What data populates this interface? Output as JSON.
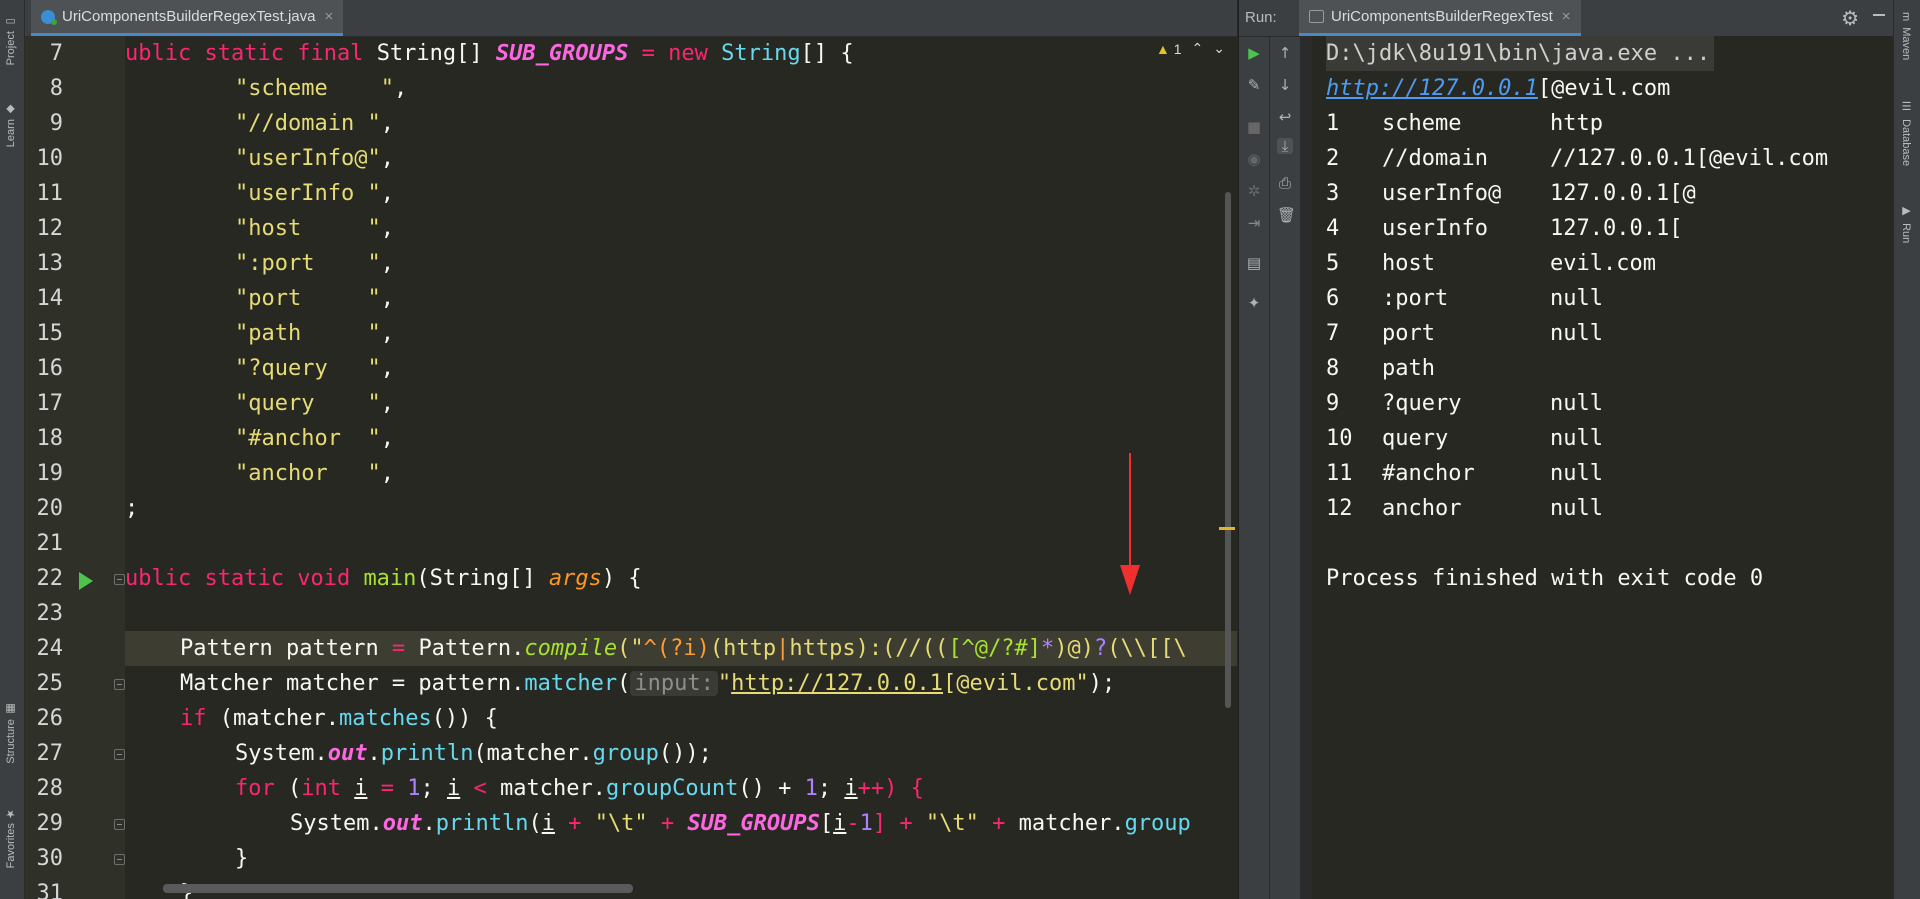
{
  "sidebar_left": [
    "Project",
    "Learn",
    "Structure",
    "Favorites"
  ],
  "sidebar_right": [
    "Maven",
    "Database",
    "Run"
  ],
  "editor": {
    "tab_title": "UriComponentsBuilderRegexTest.java",
    "warning_count": "1",
    "lines": [
      {
        "n": "7"
      },
      {
        "n": "8"
      },
      {
        "n": "9"
      },
      {
        "n": "10"
      },
      {
        "n": "11"
      },
      {
        "n": "12"
      },
      {
        "n": "13"
      },
      {
        "n": "14"
      },
      {
        "n": "15"
      },
      {
        "n": "16"
      },
      {
        "n": "17"
      },
      {
        "n": "18"
      },
      {
        "n": "19"
      },
      {
        "n": "20"
      },
      {
        "n": "21"
      },
      {
        "n": "22"
      },
      {
        "n": "23"
      },
      {
        "n": "24"
      },
      {
        "n": "25"
      },
      {
        "n": "26"
      },
      {
        "n": "27"
      },
      {
        "n": "28"
      },
      {
        "n": "29"
      },
      {
        "n": "30"
      },
      {
        "n": "31"
      }
    ],
    "code": {
      "l7": {
        "a": "ublic ",
        "b": "static ",
        "c": "final ",
        "d": "String[] ",
        "e": "SUB_GROUPS",
        "f": " = ",
        "g": "new ",
        "h": "String",
        "i": "[] {"
      },
      "groups": [
        "\"scheme    \"",
        "\"//domain \"",
        "\"userInfo@\"",
        "\"userInfo \"",
        "\"host     \"",
        "\":port    \"",
        "\"port     \"",
        "\"path     \"",
        "\"?query   \"",
        "\"query    \"",
        "\"#anchor  \"",
        "\"anchor   \""
      ],
      "comma": ",",
      "l20": ";",
      "l22": {
        "a": "ublic ",
        "b": "static ",
        "c": "void ",
        "d": "main",
        "e": "(String[] ",
        "f": "args",
        "g": ") {"
      },
      "l23": {
        "a": "Pattern ",
        "b": "pattern",
        "c": " = ",
        "d": "Pattern.",
        "e": "compile",
        "f": "(\"",
        "g": "^",
        "h": "(?i)",
        "i": "(http",
        "j": "|",
        "k": "https",
        "l": "):(//",
        "m": "((",
        "n": "[^@",
        "o": "/?#]",
        "p": "*",
        "q": ")@)",
        "r": "?",
        "s": "(\\\\[[\\"
      },
      "l24": {
        "a": "Matcher ",
        "b": "matcher = pattern.",
        "c": "matcher",
        "d": "(",
        "e": "input:",
        "f": "\"",
        "g": "http://127.0.0.1",
        "h": "[@evil.com\"",
        "i": ");"
      },
      "l25": {
        "a": "if ",
        "b": "(matcher.",
        "c": "matches",
        "d": "()) {"
      },
      "l26": {
        "a": "System.",
        "b": "out",
        "c": ".",
        "d": "println",
        "e": "(matcher.",
        "f": "group",
        "g": "());"
      },
      "l27": {
        "a": "for ",
        "b": "(",
        "c": "int ",
        "d": "i",
        "e": " = ",
        "f": "1",
        "g": "; ",
        "h": "i",
        "i": " < ",
        "j": "matcher.",
        "k": "groupCount",
        "l": "() + ",
        "m": "1",
        "n": "; ",
        "o": "i",
        "p": "++) {"
      },
      "l28": {
        "a": "System.",
        "b": "out",
        "c": ".",
        "d": "println",
        "e": "(",
        "f": "i",
        "g": " + ",
        "h": "\"\\t\"",
        "i": " + ",
        "j": "SUB_GROUPS",
        "k": "[",
        "l": "i",
        "m": "-",
        "n": "1",
        "o": "] + ",
        "p": "\"\\t\"",
        "q": " + ",
        "r": "matcher.",
        "s": "group"
      },
      "l29": "}",
      "l30": "}"
    }
  },
  "run": {
    "label": "Run:",
    "tab_title": "UriComponentsBuilderRegexTest",
    "command": "D:\\jdk\\8u191\\bin\\java.exe ...",
    "url_link": "http://127.0.0.1",
    "url_rest": "[@evil.com",
    "rows": [
      {
        "i": "1",
        "name": "scheme",
        "value": "http"
      },
      {
        "i": "2",
        "name": "//domain",
        "value": "//127.0.0.1[@evil.com"
      },
      {
        "i": "3",
        "name": "userInfo@",
        "value": "127.0.0.1[@"
      },
      {
        "i": "4",
        "name": "userInfo",
        "value": "127.0.0.1["
      },
      {
        "i": "5",
        "name": "host",
        "value": "evil.com"
      },
      {
        "i": "6",
        "name": ":port",
        "value": "null"
      },
      {
        "i": "7",
        "name": "port",
        "value": "null"
      },
      {
        "i": "8",
        "name": "path",
        "value": ""
      },
      {
        "i": "9",
        "name": "?query",
        "value": "null"
      },
      {
        "i": "10",
        "name": "query",
        "value": "null"
      },
      {
        "i": "11",
        "name": "#anchor",
        "value": "null"
      },
      {
        "i": "12",
        "name": "anchor",
        "value": "null"
      }
    ],
    "finish": "Process finished with exit code 0"
  }
}
